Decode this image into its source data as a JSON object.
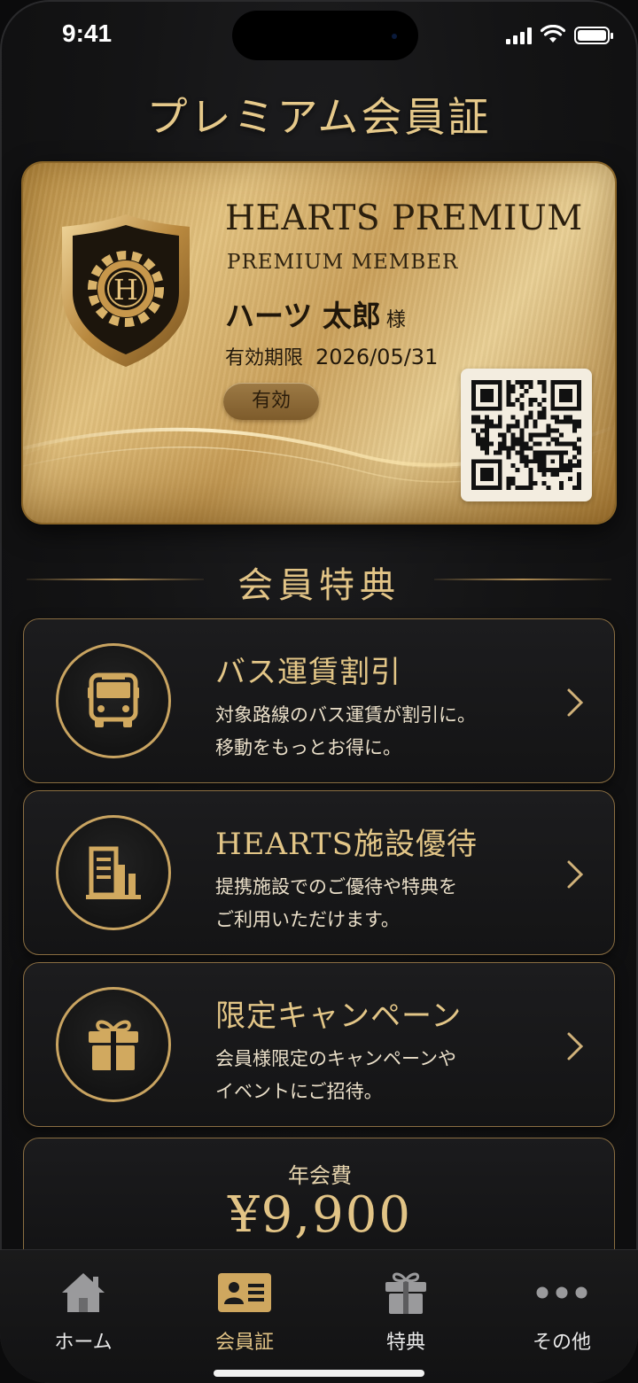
{
  "status_bar": {
    "time": "9:41"
  },
  "page": {
    "title": "プレミアム会員証"
  },
  "member_card": {
    "brand": "HEARTS PREMIUM",
    "tier": "PREMIUM MEMBER",
    "emblem_letter": "H",
    "member_name": "ハーツ 太郎",
    "honorific": "様",
    "expiry_label": "有効期限",
    "expiry_date": "2026/05/31",
    "status": "有効",
    "colors": {
      "gold_light": "#e3c27f",
      "gold_dark": "#a97b35",
      "text_dark": "#2a1e0d"
    }
  },
  "benefits": {
    "section_title": "会員特典",
    "items": [
      {
        "icon": "bus-icon",
        "title": "バス運賃割引",
        "desc_line1": "対象路線のバス運賃が割引に。",
        "desc_line2": "移動をもっとお得に。"
      },
      {
        "icon": "building-icon",
        "title": "HEARTS施設優待",
        "desc_line1": "提携施設でのご優待や特典を",
        "desc_line2": "ご利用いただけます。"
      },
      {
        "icon": "gift-icon",
        "title": "限定キャンペーン",
        "desc_line1": "会員様限定のキャンペーンや",
        "desc_line2": "イベントにご招待。"
      }
    ]
  },
  "annual_fee": {
    "label": "年会費",
    "value": "¥9,900"
  },
  "tab_bar": {
    "active": "membership",
    "tabs": [
      {
        "id": "home",
        "icon": "home-icon",
        "label": "ホーム"
      },
      {
        "id": "membership",
        "icon": "member-card-icon",
        "label": "会員証"
      },
      {
        "id": "benefits",
        "icon": "gift-icon",
        "label": "特典"
      },
      {
        "id": "more",
        "icon": "more-icon",
        "label": "その他"
      }
    ]
  },
  "theme": {
    "accent_gold": "#e2c486",
    "background": "#141415",
    "border_gold": "#8a6e42"
  }
}
